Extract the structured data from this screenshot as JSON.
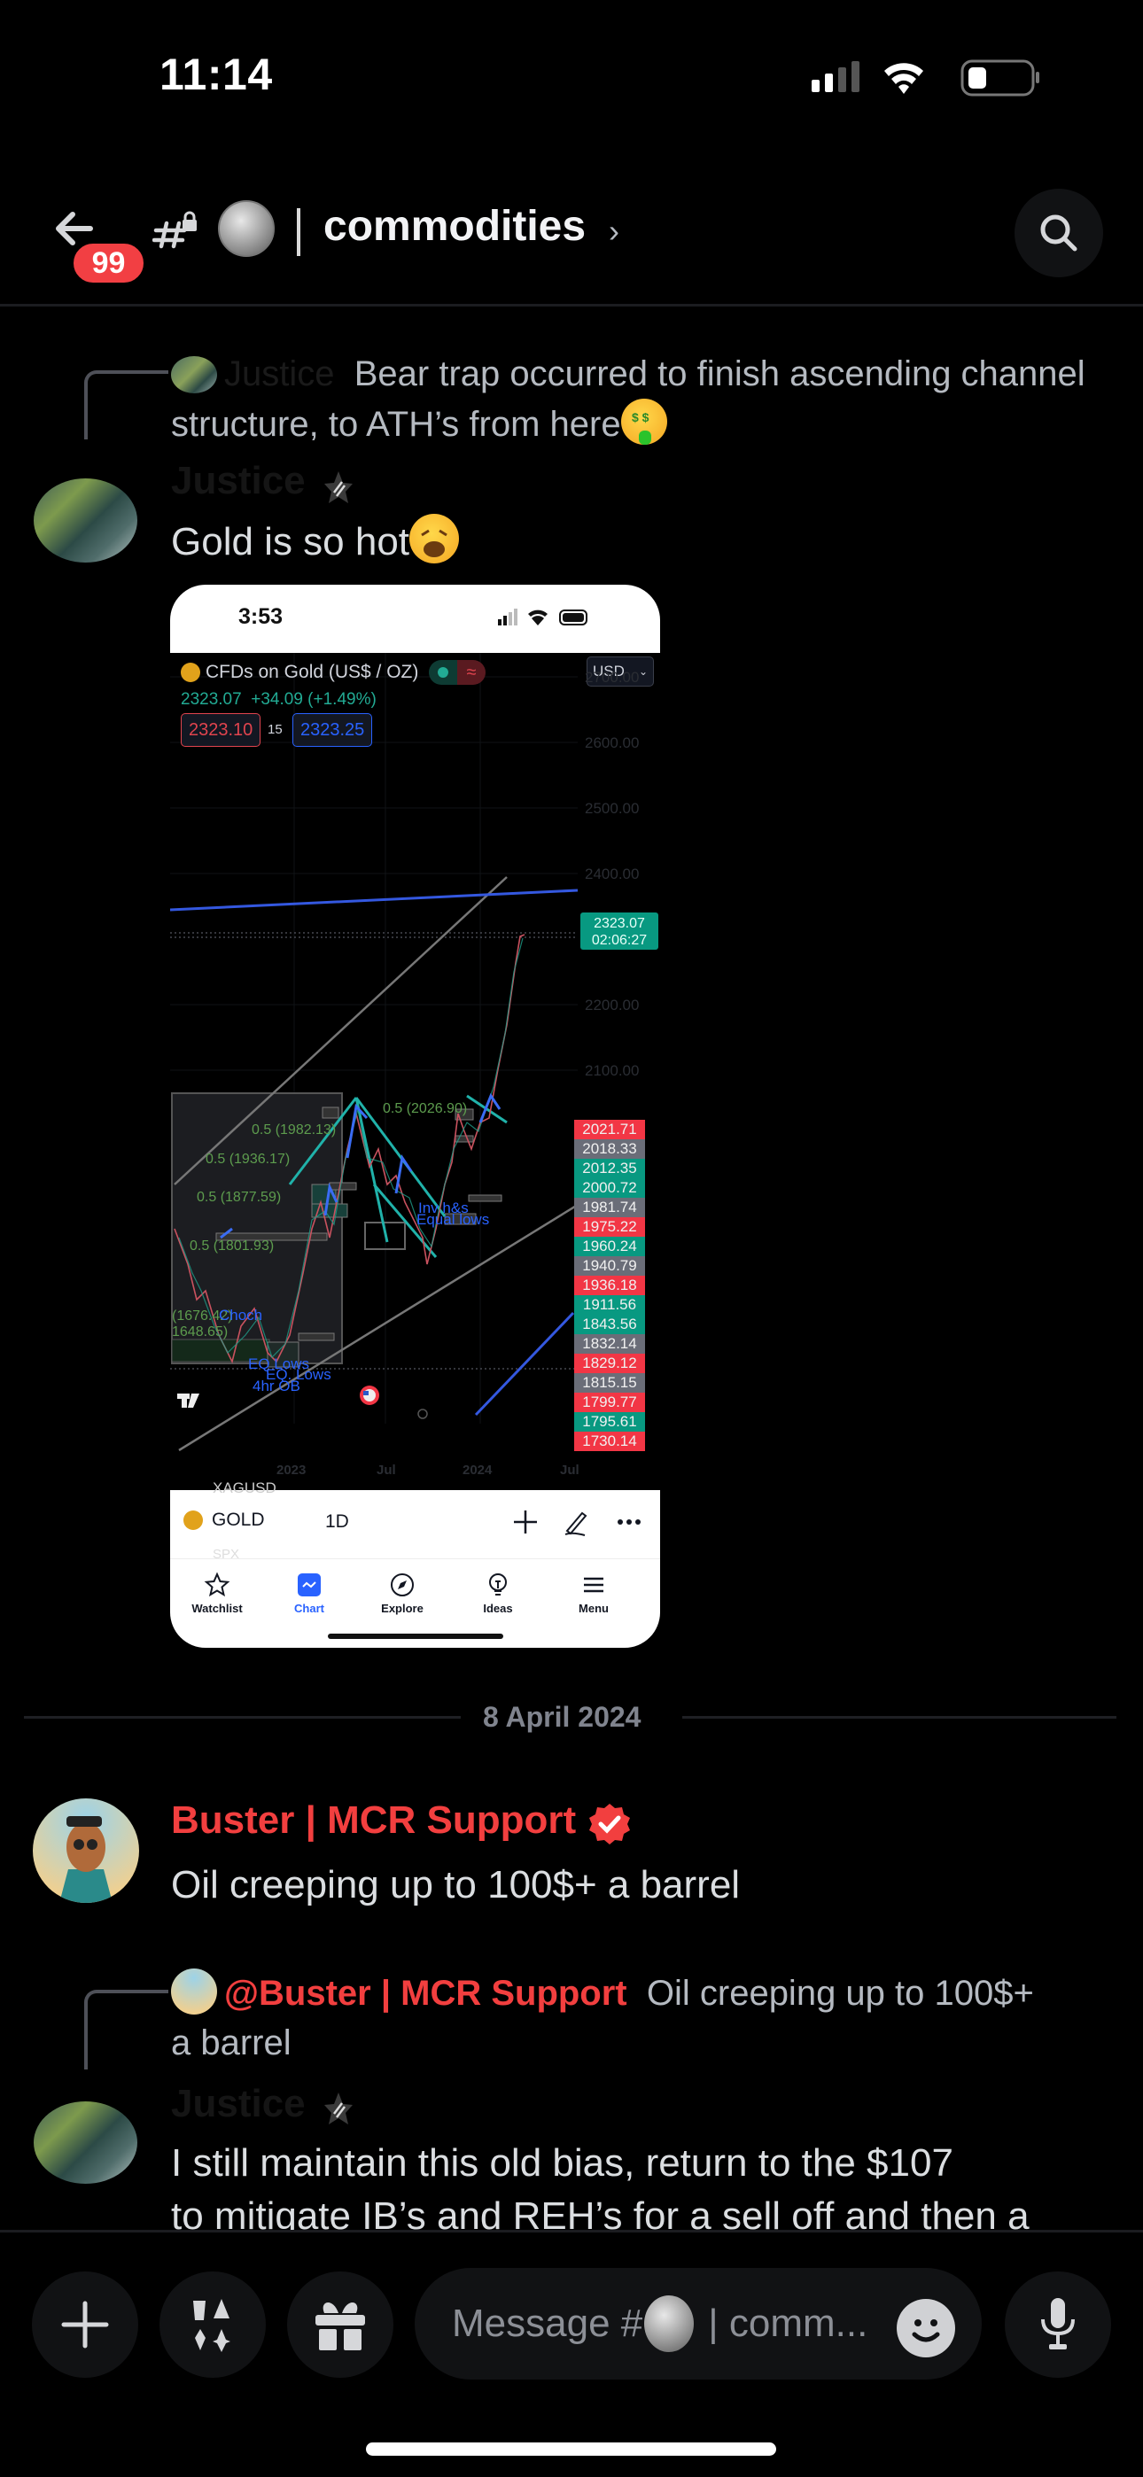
{
  "status_bar": {
    "time": "11:14",
    "battery_level": 0.2
  },
  "header": {
    "unread_badge": "99",
    "channel_name": "commodities",
    "chevron": "›",
    "icons": {
      "back": "arrow-left-icon",
      "channel": "hash-lock-icon",
      "server": "silver-coin-icon",
      "search": "search-icon"
    }
  },
  "messages": [
    {
      "type": "reply-preview",
      "reply_author": "Justice",
      "reply_text": "Bear trap occurred to finish ascending channel structure, to ATH’s from here",
      "reply_emoji": "money-mouth-face"
    },
    {
      "author": "Justice",
      "author_icon": "role-star-icon",
      "text": "Gold is so hot",
      "emoji": "weary-face",
      "attachment": {
        "phone_time": "3:53",
        "instrument_title": "CFDs on Gold (US$ / OZ)",
        "currency": "USD",
        "last_price": "2323.07",
        "change": "+34.09 (+1.49%)",
        "bid": "2323.10",
        "spread": "15",
        "ask": "2323.25",
        "last_price_tag": "2323.07",
        "countdown": "02:06:27",
        "axis_labels": [
          "2700.00",
          "2600.00",
          "2500.00",
          "2400.00",
          "2200.00",
          "2100.00"
        ],
        "x_labels": [
          "2023",
          "Jul",
          "2024",
          "Jul"
        ],
        "price_tags": [
          {
            "value": "2021.71",
            "color": "red"
          },
          {
            "value": "2018.33",
            "color": "gray"
          },
          {
            "value": "2012.35",
            "color": "green"
          },
          {
            "value": "2000.72",
            "color": "green"
          },
          {
            "value": "1981.74",
            "color": "gray"
          },
          {
            "value": "1975.22",
            "color": "red"
          },
          {
            "value": "1960.24",
            "color": "green"
          },
          {
            "value": "1940.79",
            "color": "gray"
          },
          {
            "value": "1936.18",
            "color": "red"
          },
          {
            "value": "1911.56",
            "color": "green"
          },
          {
            "value": "1843.56",
            "color": "green"
          },
          {
            "value": "1832.14",
            "color": "gray"
          },
          {
            "value": "1829.12",
            "color": "red"
          },
          {
            "value": "1815.15",
            "color": "gray"
          },
          {
            "value": "1799.77",
            "color": "red"
          },
          {
            "value": "1795.61",
            "color": "green"
          },
          {
            "value": "1730.14",
            "color": "red"
          }
        ],
        "fib_labels": [
          "0.5 (2026.90)",
          "0.5 (1982.13)",
          "0.5 (1936.17)",
          "0.5 (1877.59)",
          "0.5 (1801.93)",
          "(1676.42)",
          "1648.65)"
        ],
        "blue_annotations": [
          "Inv h&s",
          "Equal lows",
          "Choch",
          "EQ Lows",
          "EQ. Lows",
          "4hr OB"
        ],
        "symbol": "GOLD",
        "interval": "1D",
        "ghost_symbols": [
          "XAGUSD",
          "SPX"
        ],
        "nav": [
          {
            "label": "Watchlist",
            "icon": "star-icon",
            "active": false
          },
          {
            "label": "Chart",
            "icon": "chart-icon",
            "active": true
          },
          {
            "label": "Explore",
            "icon": "compass-icon",
            "active": false
          },
          {
            "label": "Ideas",
            "icon": "lightbulb-icon",
            "active": false
          },
          {
            "label": "Menu",
            "icon": "menu-icon",
            "active": false
          }
        ]
      }
    },
    {
      "type": "date-divider",
      "text": "8 April 2024"
    },
    {
      "author": "Buster | MCR Support",
      "author_color": "#f23f3f",
      "author_icon": "verified-badge-icon",
      "text": "Oil creeping up to 100$+ a barrel"
    },
    {
      "type": "reply-preview",
      "reply_author": "@Buster | MCR Support",
      "reply_text": "Oil creeping up to 100$+ a barrel"
    },
    {
      "author": "Justice",
      "author_icon": "role-star-icon",
      "text_line1": "I still maintain this old bias, return to the $107",
      "text_line2": "to mitigate IB’s and REH’s for a sell off and then a"
    }
  ],
  "composer": {
    "placeholder_prefix": "Message #",
    "placeholder_suffix": "| comm...",
    "buttons": [
      "plus-icon",
      "apps-icon",
      "gift-icon",
      "emoji-icon",
      "microphone-icon"
    ]
  }
}
